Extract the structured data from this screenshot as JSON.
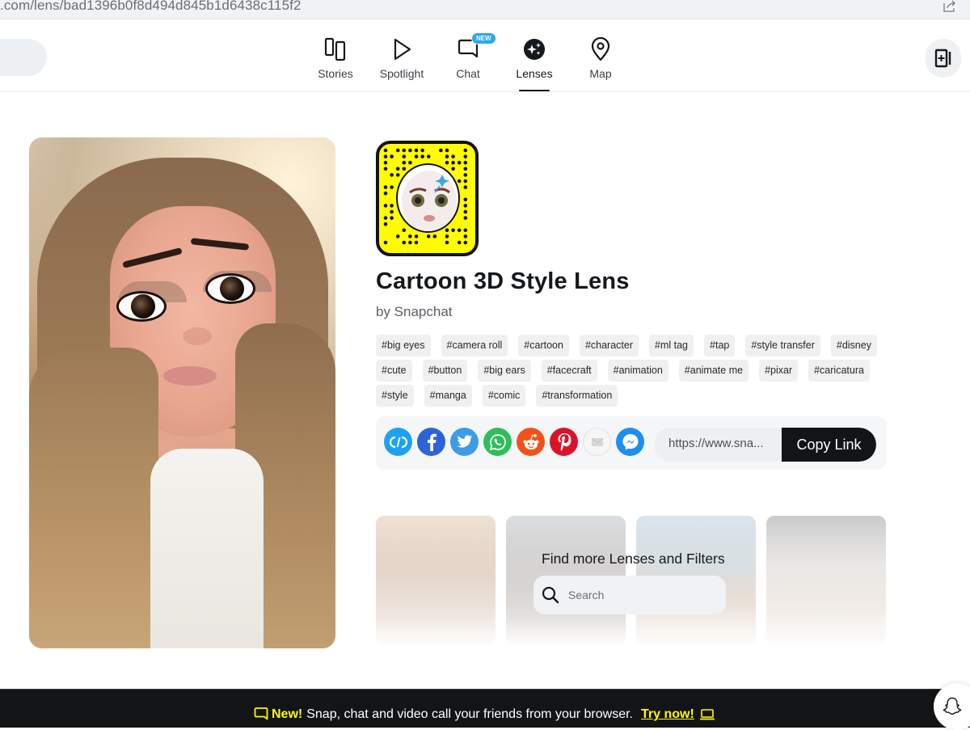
{
  "browser": {
    "url": ".com/lens/bad1396b0f8d494d845b1d6438c115f2"
  },
  "nav": {
    "items": [
      {
        "label": "Stories",
        "icon": "stories-icon",
        "active": false
      },
      {
        "label": "Spotlight",
        "icon": "spotlight-play-icon",
        "active": false
      },
      {
        "label": "Chat",
        "icon": "chat-bubble-icon",
        "active": false,
        "badge": "NEW"
      },
      {
        "label": "Lenses",
        "icon": "lenses-sparkle-icon",
        "active": true
      },
      {
        "label": "Map",
        "icon": "map-pin-icon",
        "active": false
      }
    ]
  },
  "lens": {
    "title": "Cartoon 3D Style Lens",
    "creator": "by Snapchat",
    "tags": [
      "#big eyes",
      "#camera roll",
      "#cartoon",
      "#character",
      "#ml tag",
      "#tap",
      "#style transfer",
      "#disney",
      "#cute",
      "#button",
      "#big ears",
      "#facecraft",
      "#animation",
      "#animate me",
      "#pixar",
      "#caricatura",
      "#style",
      "#manga",
      "#comic",
      "#transformation"
    ]
  },
  "share": {
    "services": [
      {
        "name": "embed",
        "color": "#1fa1f1"
      },
      {
        "name": "facebook",
        "color": "#2c64d8"
      },
      {
        "name": "twitter",
        "color": "#3d9be9"
      },
      {
        "name": "whatsapp",
        "color": "#2dbe5a"
      },
      {
        "name": "reddit",
        "color": "#f2521a"
      },
      {
        "name": "pinterest",
        "color": "#d9142a"
      },
      {
        "name": "email",
        "color": "#f4f4f4"
      },
      {
        "name": "messenger",
        "color": "#1f8ef1"
      }
    ],
    "link_value": "https://www.sna...",
    "copy_label": "Copy Link"
  },
  "discover": {
    "title": "Find more Lenses and Filters",
    "search_placeholder": "Search"
  },
  "banner": {
    "new_label": "New!",
    "message": "Snap, chat and video call your friends from your browser.",
    "cta": "Try now!"
  },
  "colors": {
    "brand_yellow": "#fffc00",
    "dark": "#121416"
  }
}
